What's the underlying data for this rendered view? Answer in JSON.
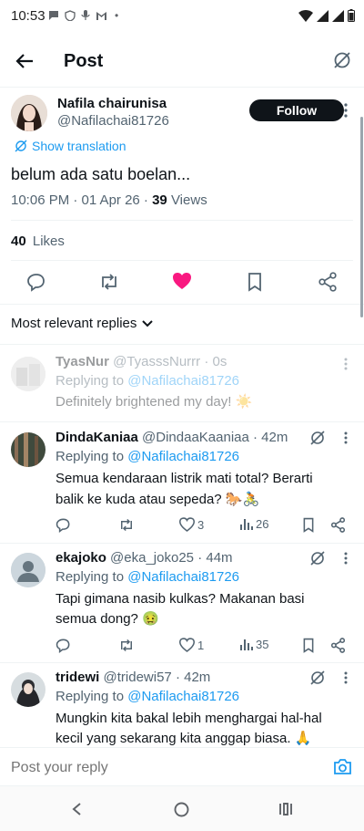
{
  "status": {
    "time": "10:53",
    "dot": "•"
  },
  "header": {
    "title": "Post"
  },
  "post": {
    "author_name": "Nafila chairunisa",
    "author_handle": "@Nafilachai81726",
    "follow_label": "Follow",
    "show_translation": "Show translation",
    "text": "belum ada satu boelan...",
    "meta_date": "10:06 PM · 01 Apr 26 · ",
    "views_count": "39",
    "views_label": " Views",
    "likes_count": "40",
    "likes_label": "Likes"
  },
  "sort": {
    "label": "Most relevant replies"
  },
  "replies": [
    {
      "name": "TyasNur",
      "handle": "@TyasssNurrr",
      "time": "· 0s",
      "replying_to": "Replying to ",
      "replying_handle": "@Nafilachai81726",
      "text": "Definitely brightened my day! ☀️"
    },
    {
      "name": "DindaKaniaa",
      "handle": "@DindaaKaaniaa",
      "time": "· 42m",
      "replying_to": "Replying to ",
      "replying_handle": "@Nafilachai81726",
      "text_line1": "Semua kendaraan listrik mati total? Berarti",
      "text_line2": "balik ke kuda atau sepeda? 🐎🚴",
      "likes": "3",
      "views": "26"
    },
    {
      "name": "ekajoko",
      "handle": "@eka_joko25",
      "time": "· 44m",
      "replying_to": "Replying to ",
      "replying_handle": "@Nafilachai81726",
      "text_line1": "Tapi gimana nasib kulkas? Makanan basi",
      "text_line2": "semua dong? 🤢",
      "likes": "1",
      "views": "35"
    },
    {
      "name": "tridewi",
      "handle": "@tridewi57",
      "time": "· 42m",
      "replying_to": "Replying to ",
      "replying_handle": "@Nafilachai81726",
      "text_line1": "Mungkin kita bakal lebih menghargai hal-hal",
      "text_line2": "kecil yang sekarang kita anggap biasa. 🙏"
    }
  ],
  "composer": {
    "placeholder": "Post your reply"
  },
  "colors": {
    "accent": "#1d9bf0",
    "like": "#f91880",
    "text": "#0f1419",
    "muted": "#536471"
  }
}
